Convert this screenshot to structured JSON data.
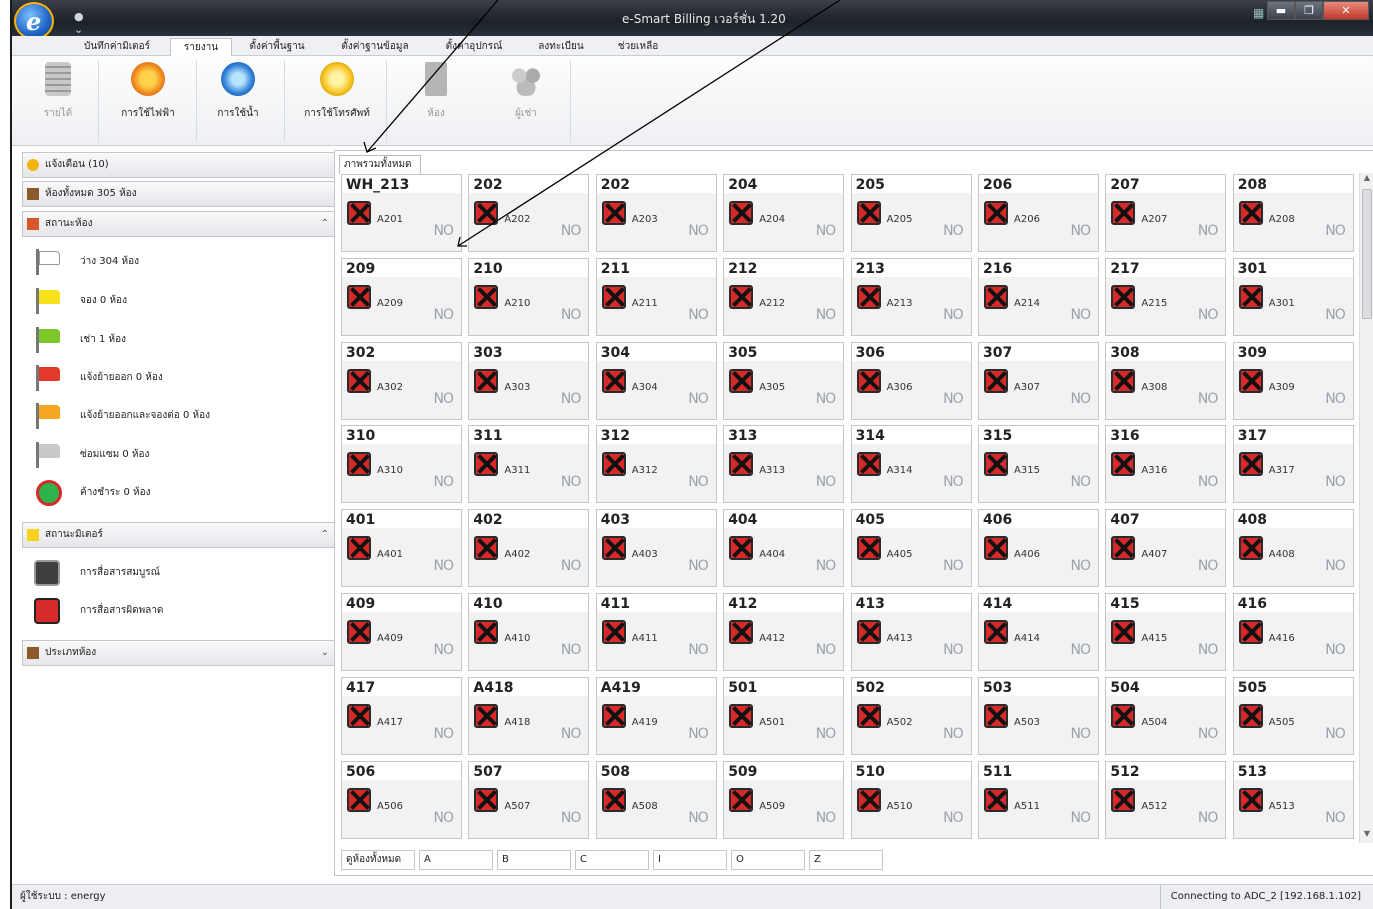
{
  "window": {
    "title": "e-Smart Billing เวอร์ชั่น 1.20",
    "controls": [
      "▬",
      "❐",
      "✕"
    ]
  },
  "ribbon_tabs": [
    {
      "label": "บันทึกค่ามิเตอร์",
      "active": false
    },
    {
      "label": "รายงาน",
      "active": true
    },
    {
      "label": "ตั้งค่าพื้นฐาน",
      "active": false
    },
    {
      "label": "ตั้งค่าฐานข้อมูล",
      "active": false
    },
    {
      "label": "ตั้งค่าอุปกรณ์",
      "active": false
    },
    {
      "label": "ลงทะเบียน",
      "active": false
    },
    {
      "label": "ช่วยเหลือ",
      "active": false
    }
  ],
  "ribbon_buttons": [
    {
      "label": "รายได้",
      "icon": "coins-icon",
      "enabled": false
    },
    {
      "label": "การใช้ไฟฟ้า",
      "icon": "electricity-icon",
      "enabled": true
    },
    {
      "label": "การใช้น้ำ",
      "icon": "water-icon",
      "enabled": true
    },
    {
      "label": "การใช้โทรศัพท์",
      "icon": "phone-icon",
      "enabled": true
    },
    {
      "label": "ห้อง",
      "icon": "door-icon",
      "enabled": false
    },
    {
      "label": "ผู้เช่า",
      "icon": "tenants-icon",
      "enabled": false
    }
  ],
  "sidebar": {
    "alerts": "แจ้งเตือน (10)",
    "total_rooms": "ห้องทั้งหมด 305 ห้อง",
    "room_status_header": "สถานะห้อง",
    "room_status": [
      {
        "label": "ว่าง 304 ห้อง",
        "color": "#ffffff"
      },
      {
        "label": "จอง 0 ห้อง",
        "color": "#f7e11a"
      },
      {
        "label": "เช่า 1 ห้อง",
        "color": "#7cc62a"
      },
      {
        "label": "แจ้งย้ายออก 0 ห้อง",
        "color": "#e23a2a"
      },
      {
        "label": "แจ้งย้ายออกและจองต่อ 0 ห้อง",
        "color": "#f5a623"
      },
      {
        "label": "ซ่อมแซม 0 ห้อง",
        "color": "#c9c9c9"
      },
      {
        "label": "ค้างชำระ 0 ห้อง",
        "color": "#2db34a"
      }
    ],
    "meter_status_header": "สถานะมิเตอร์",
    "meter_status": [
      {
        "label": "การสื่อสารสมบูรณ์"
      },
      {
        "label": "การสื่อสารผิดพลาด"
      }
    ],
    "room_type_header": "ประเภทห้อง"
  },
  "content": {
    "tab": "ภาพรวมทั้งหมด",
    "no_label": "NO",
    "rooms": [
      {
        "num": "WH_213",
        "code": "A201"
      },
      {
        "num": "202",
        "code": "A202"
      },
      {
        "num": "202",
        "code": "A203"
      },
      {
        "num": "204",
        "code": "A204"
      },
      {
        "num": "205",
        "code": "A205"
      },
      {
        "num": "206",
        "code": "A206"
      },
      {
        "num": "207",
        "code": "A207"
      },
      {
        "num": "208",
        "code": "A208"
      },
      {
        "num": "209",
        "code": "A209"
      },
      {
        "num": "210",
        "code": "A210"
      },
      {
        "num": "211",
        "code": "A211"
      },
      {
        "num": "212",
        "code": "A212"
      },
      {
        "num": "213",
        "code": "A213"
      },
      {
        "num": "216",
        "code": "A214"
      },
      {
        "num": "217",
        "code": "A215"
      },
      {
        "num": "301",
        "code": "A301"
      },
      {
        "num": "302",
        "code": "A302"
      },
      {
        "num": "303",
        "code": "A303"
      },
      {
        "num": "304",
        "code": "A304"
      },
      {
        "num": "305",
        "code": "A305"
      },
      {
        "num": "306",
        "code": "A306"
      },
      {
        "num": "307",
        "code": "A307"
      },
      {
        "num": "308",
        "code": "A308"
      },
      {
        "num": "309",
        "code": "A309"
      },
      {
        "num": "310",
        "code": "A310"
      },
      {
        "num": "311",
        "code": "A311"
      },
      {
        "num": "312",
        "code": "A312"
      },
      {
        "num": "313",
        "code": "A313"
      },
      {
        "num": "314",
        "code": "A314"
      },
      {
        "num": "315",
        "code": "A315"
      },
      {
        "num": "316",
        "code": "A316"
      },
      {
        "num": "317",
        "code": "A317"
      },
      {
        "num": "401",
        "code": "A401"
      },
      {
        "num": "402",
        "code": "A402"
      },
      {
        "num": "403",
        "code": "A403"
      },
      {
        "num": "404",
        "code": "A404"
      },
      {
        "num": "405",
        "code": "A405"
      },
      {
        "num": "406",
        "code": "A406"
      },
      {
        "num": "407",
        "code": "A407"
      },
      {
        "num": "408",
        "code": "A408"
      },
      {
        "num": "409",
        "code": "A409"
      },
      {
        "num": "410",
        "code": "A410"
      },
      {
        "num": "411",
        "code": "A411"
      },
      {
        "num": "412",
        "code": "A412"
      },
      {
        "num": "413",
        "code": "A413"
      },
      {
        "num": "414",
        "code": "A414"
      },
      {
        "num": "415",
        "code": "A415"
      },
      {
        "num": "416",
        "code": "A416"
      },
      {
        "num": "417",
        "code": "A417"
      },
      {
        "num": "A418",
        "code": "A418"
      },
      {
        "num": "A419",
        "code": "A419"
      },
      {
        "num": "501",
        "code": "A501"
      },
      {
        "num": "502",
        "code": "A502"
      },
      {
        "num": "503",
        "code": "A503"
      },
      {
        "num": "504",
        "code": "A504"
      },
      {
        "num": "505",
        "code": "A505"
      },
      {
        "num": "506",
        "code": "A506"
      },
      {
        "num": "507",
        "code": "A507"
      },
      {
        "num": "508",
        "code": "A508"
      },
      {
        "num": "509",
        "code": "A509"
      },
      {
        "num": "510",
        "code": "A510"
      },
      {
        "num": "511",
        "code": "A511"
      },
      {
        "num": "512",
        "code": "A512"
      },
      {
        "num": "513",
        "code": "A513"
      }
    ],
    "filters": [
      "ดูห้องทั้งหมด",
      "A",
      "B",
      "C",
      "I",
      "O",
      "Z"
    ]
  },
  "statusbar": {
    "user": "ผู้ใช้ระบบ : energy",
    "connection": "Connecting to ADC_2 [192.168.1.102]"
  }
}
